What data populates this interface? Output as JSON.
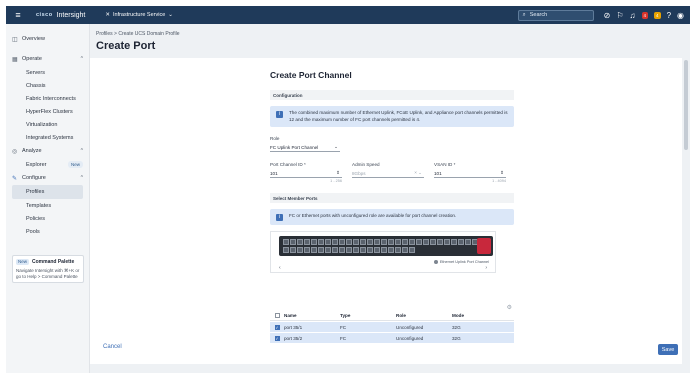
{
  "topbar": {
    "logo": "cisco",
    "app_name": "Intersight",
    "service": "Infrastructure Service",
    "search_label": "Search",
    "alert_red_count": "4",
    "alert_orange_count": "4"
  },
  "sidebar": {
    "overview": "Overview",
    "operate": "Operate",
    "operate_items": [
      "Servers",
      "Chassis",
      "Fabric Interconnects",
      "HyperFlex Clusters",
      "Virtualization",
      "Integrated Systems"
    ],
    "analyze": "Analyze",
    "explorer": "Explorer",
    "new_badge": "New",
    "configure": "Configure",
    "configure_items": [
      "Profiles",
      "Templates",
      "Policies",
      "Pools"
    ],
    "palette": {
      "badge": "New",
      "title": "Command Palette",
      "text": "Navigate Intersight with ⌘+K or go to Help > Command Palette"
    }
  },
  "main": {
    "breadcrumb": "Profiles  >  Create UCS Domain Profile",
    "title": "Create Port"
  },
  "form": {
    "title": "Create Port Channel",
    "configuration": "Configuration",
    "config_info": "The combined maximum number of Ethernet Uplink, FCoE Uplink, and Appliance port channels permitted is 12 and the maximum number of FC port channels permitted is 4.",
    "role_label": "Role",
    "role_value": "FC Uplink Port Channel",
    "port_channel_id_label": "Port Channel ID *",
    "port_channel_id_value": "101",
    "port_channel_id_hint": "1 - 256",
    "admin_speed_label": "Admin Speed",
    "admin_speed_value": "8Gbps",
    "vsan_id_label": "VSAN ID *",
    "vsan_id_value": "101",
    "vsan_id_hint": "1 - 4094",
    "select_member_ports": "Select Member Ports",
    "ports_info": "FC or Ethernet ports with unconfigured role are available for port channel creation.",
    "legend": "Ethernet Uplink Port Channel"
  },
  "table": {
    "headers": [
      "Name",
      "Type",
      "Role",
      "Mode"
    ],
    "rows": [
      {
        "name": "port 35/1",
        "type": "FC",
        "role": "Unconfigured",
        "mode": "32G"
      },
      {
        "name": "port 35/2",
        "type": "FC",
        "role": "Unconfigured",
        "mode": "32G"
      }
    ]
  },
  "footer": {
    "cancel": "Cancel",
    "save": "Save"
  }
}
